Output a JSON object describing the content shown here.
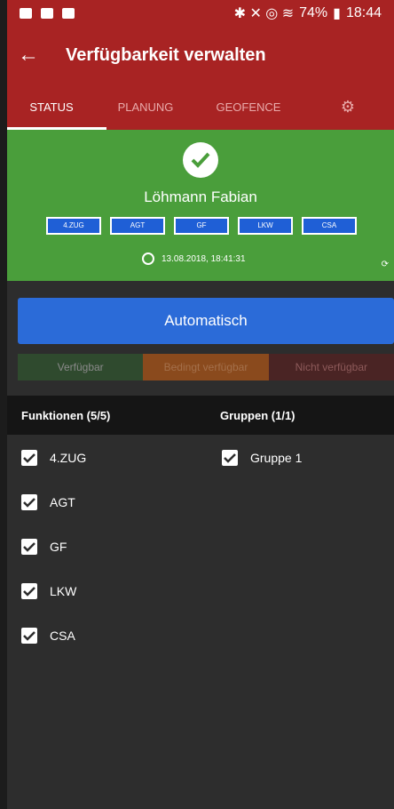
{
  "status_bar": {
    "battery_percent": "74%",
    "time": "18:44"
  },
  "app_bar": {
    "title": "Verfügbarkeit verwalten"
  },
  "tabs": [
    {
      "label": "STATUS"
    },
    {
      "label": "PLANUNG"
    },
    {
      "label": "GEOFENCE"
    }
  ],
  "person": {
    "name": "Löhmann Fabian",
    "badges": [
      "4.ZUG",
      "AGT",
      "GF",
      "LKW",
      "CSA"
    ],
    "timestamp": "13.08.2018, 18:41:31"
  },
  "auto_button_label": "Automatisch",
  "availability": {
    "available": "Verfügbar",
    "conditional": "Bedingt verfügbar",
    "unavailable": "Nicht verfügbar"
  },
  "section_headers": {
    "functions": "Funktionen (5/5)",
    "groups": "Gruppen (1/1)"
  },
  "functions": [
    "4.ZUG",
    "AGT",
    "GF",
    "LKW",
    "CSA"
  ],
  "groups": [
    "Gruppe 1"
  ],
  "colors": {
    "primary_red": "#a82323",
    "status_green": "#4a9e3b",
    "auto_blue": "#2b6bd8",
    "badge_blue": "#1f5fd6"
  }
}
